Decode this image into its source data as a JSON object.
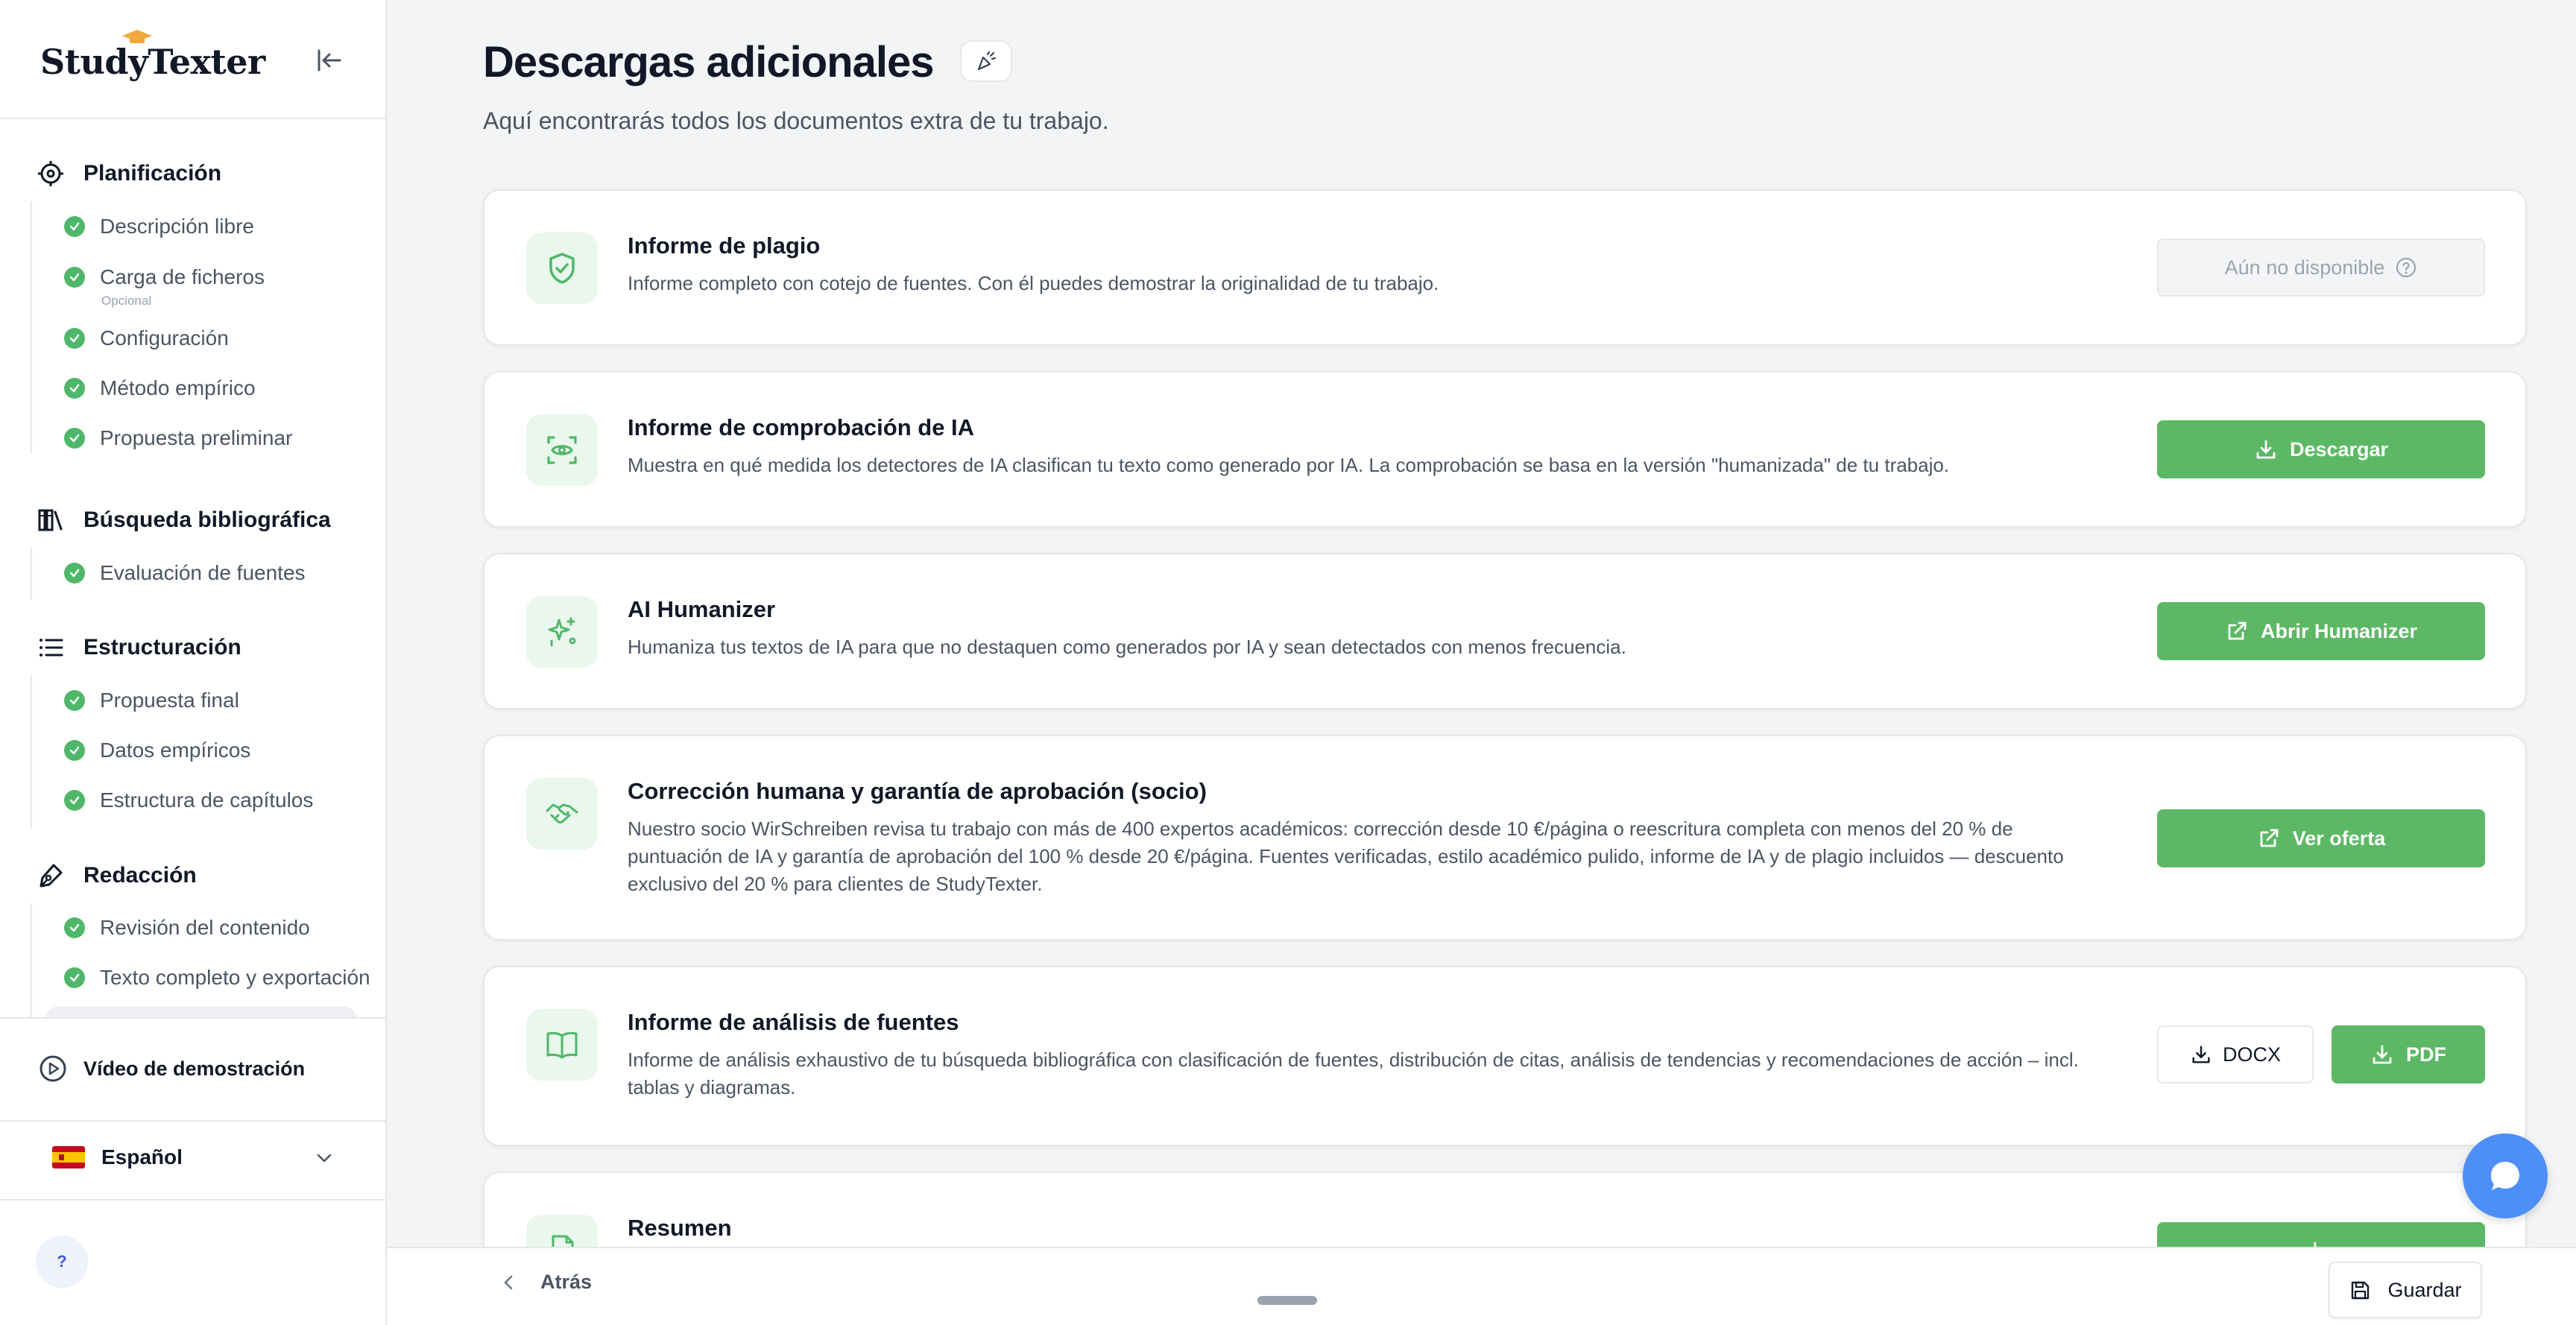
{
  "brand": {
    "logo_text": "StudyTexter"
  },
  "sidebar": {
    "sections": [
      {
        "title": "Planificación",
        "icon": "target-icon",
        "items": [
          {
            "label": "Descripción libre"
          },
          {
            "label": "Carga de ficheros",
            "sub": "Opcional"
          },
          {
            "label": "Configuración"
          },
          {
            "label": "Método empírico"
          },
          {
            "label": "Propuesta preliminar"
          }
        ]
      },
      {
        "title": "Búsqueda bibliográfica",
        "icon": "library-icon",
        "items": [
          {
            "label": "Evaluación de fuentes"
          }
        ]
      },
      {
        "title": "Estructuración",
        "icon": "list-icon",
        "items": [
          {
            "label": "Propuesta final"
          },
          {
            "label": "Datos empíricos"
          },
          {
            "label": "Estructura de capítulos"
          }
        ]
      },
      {
        "title": "Redacción",
        "icon": "pen-icon",
        "items": [
          {
            "label": "Revisión del contenido"
          },
          {
            "label": "Texto completo y exportación"
          }
        ]
      }
    ],
    "demo_label": "Vídeo de demostración",
    "language": "Español",
    "help_label": "?"
  },
  "main": {
    "title": "Descargas adicionales",
    "subtitle": "Aquí encontrarás todos los documentos extra de tu trabajo.",
    "cards": [
      {
        "title": "Informe de plagio",
        "desc": "Informe completo con cotejo de fuentes. Con él puedes demostrar la originalidad de tu trabajo.",
        "action": "Aún no disponible",
        "icon": "shield-check-icon"
      },
      {
        "title": "Informe de comprobación de IA",
        "desc": "Muestra en qué medida los detectores de IA clasifican tu texto como generado por IA. La comprobación se basa en la versión \"humanizada\" de tu trabajo.",
        "action": "Descargar",
        "icon": "scan-eye-icon"
      },
      {
        "title": "AI Humanizer",
        "desc": "Humaniza tus textos de IA para que no destaquen como generados por IA y sean detectados con menos frecuencia.",
        "action": "Abrir Humanizer",
        "icon": "sparkles-icon"
      },
      {
        "title": "Corrección humana y garantía de aprobación (socio)",
        "desc": "Nuestro socio WirSchreiben revisa tu trabajo con más de 400 expertos académicos: corrección desde 10 €/página o reescritura completa con menos del 20 % de puntuación de IA y garantía de aprobación del 100 % desde 20 €/página. Fuentes verificadas, estilo académico pulido, informe de IA y de plagio incluidos — descuento exclusivo del 20 % para clientes de StudyTexter.",
        "action": "Ver oferta",
        "icon": "handshake-icon"
      },
      {
        "title": "Informe de análisis de fuentes",
        "desc": "Informe de análisis exhaustivo de tu búsqueda bibliográfica con clasificación de fuentes, distribución de citas, análisis de tendencias y recomendaciones de acción – incl. tablas y diagramas.",
        "action_docx": "DOCX",
        "action_pdf": "PDF",
        "icon": "book-open-icon"
      },
      {
        "title": "Resumen",
        "icon": "file-icon"
      }
    ]
  },
  "footer": {
    "back_label": "Atrás",
    "save_label": "Guardar"
  },
  "colors": {
    "accent_green": "#5cb865",
    "check_green": "#4fb769",
    "icon_bg": "#e9f7ed",
    "chat_blue": "#4e8ef7"
  }
}
